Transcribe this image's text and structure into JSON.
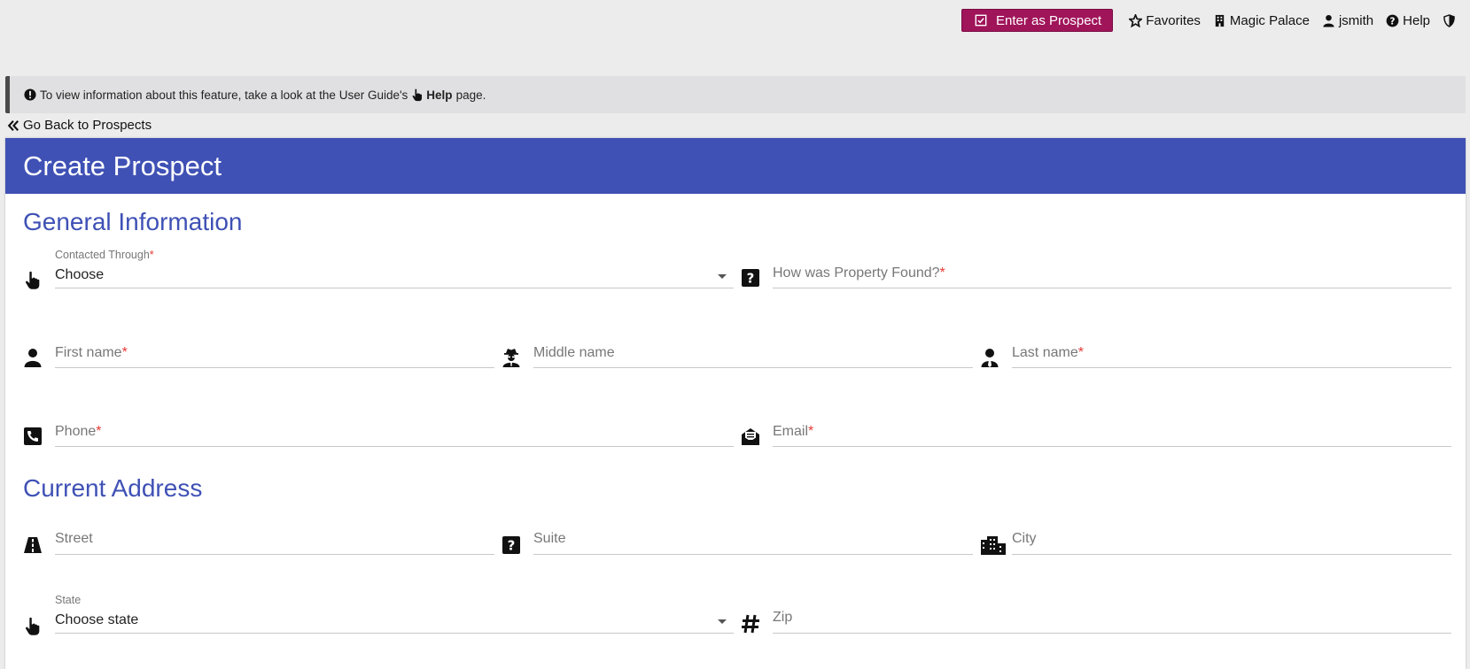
{
  "topbar": {
    "enter_button": "Enter as Prospect",
    "nav": [
      {
        "label": "Favorites",
        "icon": "star-icon"
      },
      {
        "label": "Magic Palace",
        "icon": "building-icon"
      },
      {
        "label": "jsmith",
        "icon": "user-icon"
      },
      {
        "label": "Help",
        "icon": "question-circle-icon"
      }
    ]
  },
  "alert": {
    "before": "To view information about this feature, take a look at the User Guide's",
    "link": "Help",
    "after": "page."
  },
  "back_link": "Go Back to Prospects",
  "card": {
    "title": "Create Prospect",
    "general_title": "General Information",
    "address_title": "Current Address"
  },
  "fields": {
    "contacted_through": {
      "label": "Contacted Through",
      "value": "Choose",
      "required": "*"
    },
    "property_found": {
      "placeholder": "How was Property Found?",
      "required": "*"
    },
    "first_name": {
      "placeholder": "First name",
      "required": "*"
    },
    "middle_name": {
      "placeholder": "Middle name"
    },
    "last_name": {
      "placeholder": "Last name",
      "required": "*"
    },
    "phone": {
      "placeholder": "Phone",
      "required": "*"
    },
    "email": {
      "placeholder": "Email",
      "required": "*"
    },
    "street": {
      "placeholder": "Street"
    },
    "suite": {
      "placeholder": "Suite"
    },
    "city": {
      "placeholder": "City"
    },
    "state": {
      "label": "State",
      "value": "Choose state"
    },
    "zip": {
      "placeholder": "Zip"
    }
  },
  "colors": {
    "primary": "#3f51b5",
    "accent": "#a0145a",
    "required": "#e53935"
  }
}
